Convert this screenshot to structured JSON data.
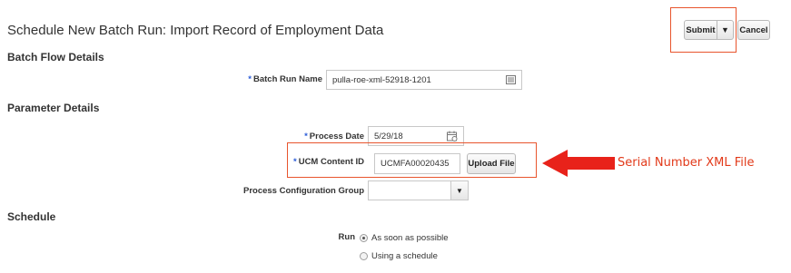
{
  "page": {
    "title": "Schedule New Batch Run: Import Record of Employment Data"
  },
  "toolbar": {
    "submit_label": "Submit",
    "submit_menu_icon": "caret-down-icon",
    "cancel_label": "Cancel"
  },
  "batch_flow": {
    "heading": "Batch Flow Details",
    "batch_run_name_label": "Batch Run Name",
    "batch_run_name_value": "pulla-roe-xml-52918-1201",
    "batch_run_name_icon": "details-icon"
  },
  "parameters": {
    "heading": "Parameter Details",
    "process_date_label": "Process Date",
    "process_date_value": "5/29/18",
    "process_date_icon": "calendar-icon",
    "ucm_label": "UCM Content ID",
    "ucm_value": "UCMFA00020435",
    "upload_label": "Upload File",
    "config_group_label": "Process Configuration Group",
    "config_group_value": ""
  },
  "required_marker": "*",
  "schedule": {
    "heading": "Schedule",
    "run_label": "Run",
    "options": [
      "As soon as possible",
      "Using a schedule"
    ],
    "selected_index": 0
  },
  "annotation": {
    "text": "Serial Number XML File",
    "color": "#e8221a"
  },
  "colors": {
    "highlight_border": "#e8552d",
    "required_asterisk": "#2a5bd7"
  }
}
